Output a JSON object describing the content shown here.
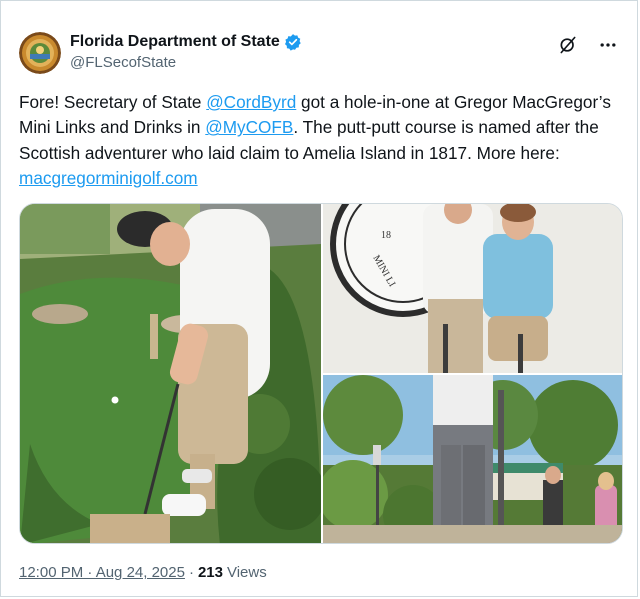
{
  "account": {
    "display_name": "Florida Department of State",
    "handle": "@FLSecofState",
    "verified_icon": "verified-badge-icon",
    "verified_color": "#1d9bf0"
  },
  "tweet": {
    "text_1": "Fore! Secretary of State ",
    "mention_1": "@CordByrd",
    "text_2": " got a hole-in-one at Gregor MacGregor’s Mini Links and Drinks in ",
    "mention_2": "@MyCOFB",
    "text_3": ". The putt-putt course is named after the Scottish adventurer who laid claim to Amelia Island in 1817. More here: ",
    "link": "macgregorminigolf.com"
  },
  "media": {
    "photos": [
      {
        "id": "golfer-putting"
      },
      {
        "id": "couple-posing"
      },
      {
        "id": "course-wide"
      }
    ],
    "sign_text": "MINI LI",
    "sign_number": "18"
  },
  "meta": {
    "time": "12:00 PM · Aug 24, 2025",
    "separator": "·",
    "views_count": "213",
    "views_label": "Views"
  },
  "actions": {
    "grok_icon": "grok-icon",
    "more_icon": "more-icon"
  },
  "colors": {
    "accent": "#1d9bf0",
    "text": "#0f1419",
    "secondary": "#536471",
    "border": "#cfd9de"
  }
}
